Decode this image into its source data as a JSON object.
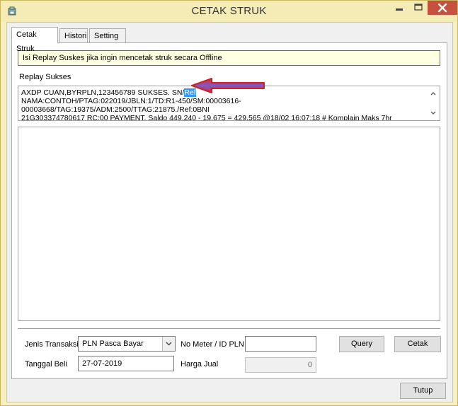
{
  "window": {
    "title": "CETAK STRUK"
  },
  "tabs": [
    {
      "label": "Cetak Struk",
      "active": true
    },
    {
      "label": "Histori",
      "active": false
    },
    {
      "label": "Setting",
      "active": false
    }
  ],
  "info": {
    "text": "Isi Replay Suskes jika ingin mencetak struk secara Offline"
  },
  "replay": {
    "label": "Replay Sukses",
    "line1_before": "AXDP CUAN,BYRPLN,123456789 SUKSES. SN/",
    "line1_selected": "Ref",
    "line2": "NAMA:CONTOH/PTAG:022019/JBLN:1/TD:R1-450/SM:00003616-00003668/TAG:19375/ADM:2500/TTAG:21875./Ref:0BNI",
    "line3": "21G303374780617 RC:00 PAYMENT. Saldo 449.240 - 19.675 = 429.565 @18/02 16:07:18 #  Komplain Maks 7hr"
  },
  "form": {
    "jenis_label": "Jenis Transaksi",
    "jenis_value": "PLN Pasca Bayar",
    "meter_label": "No Meter / ID PLN",
    "meter_value": "",
    "tanggal_label": "Tanggal Beli",
    "tanggal_value": "27-07-2019",
    "harga_label": "Harga Jual",
    "harga_value": "0"
  },
  "buttons": {
    "query": "Query",
    "cetak": "Cetak",
    "tutup": "Tutup"
  },
  "colors": {
    "titlebar": "#f4ecb4",
    "close": "#c7503f",
    "selection": "#3399ff",
    "arrow": "#e3262c"
  }
}
